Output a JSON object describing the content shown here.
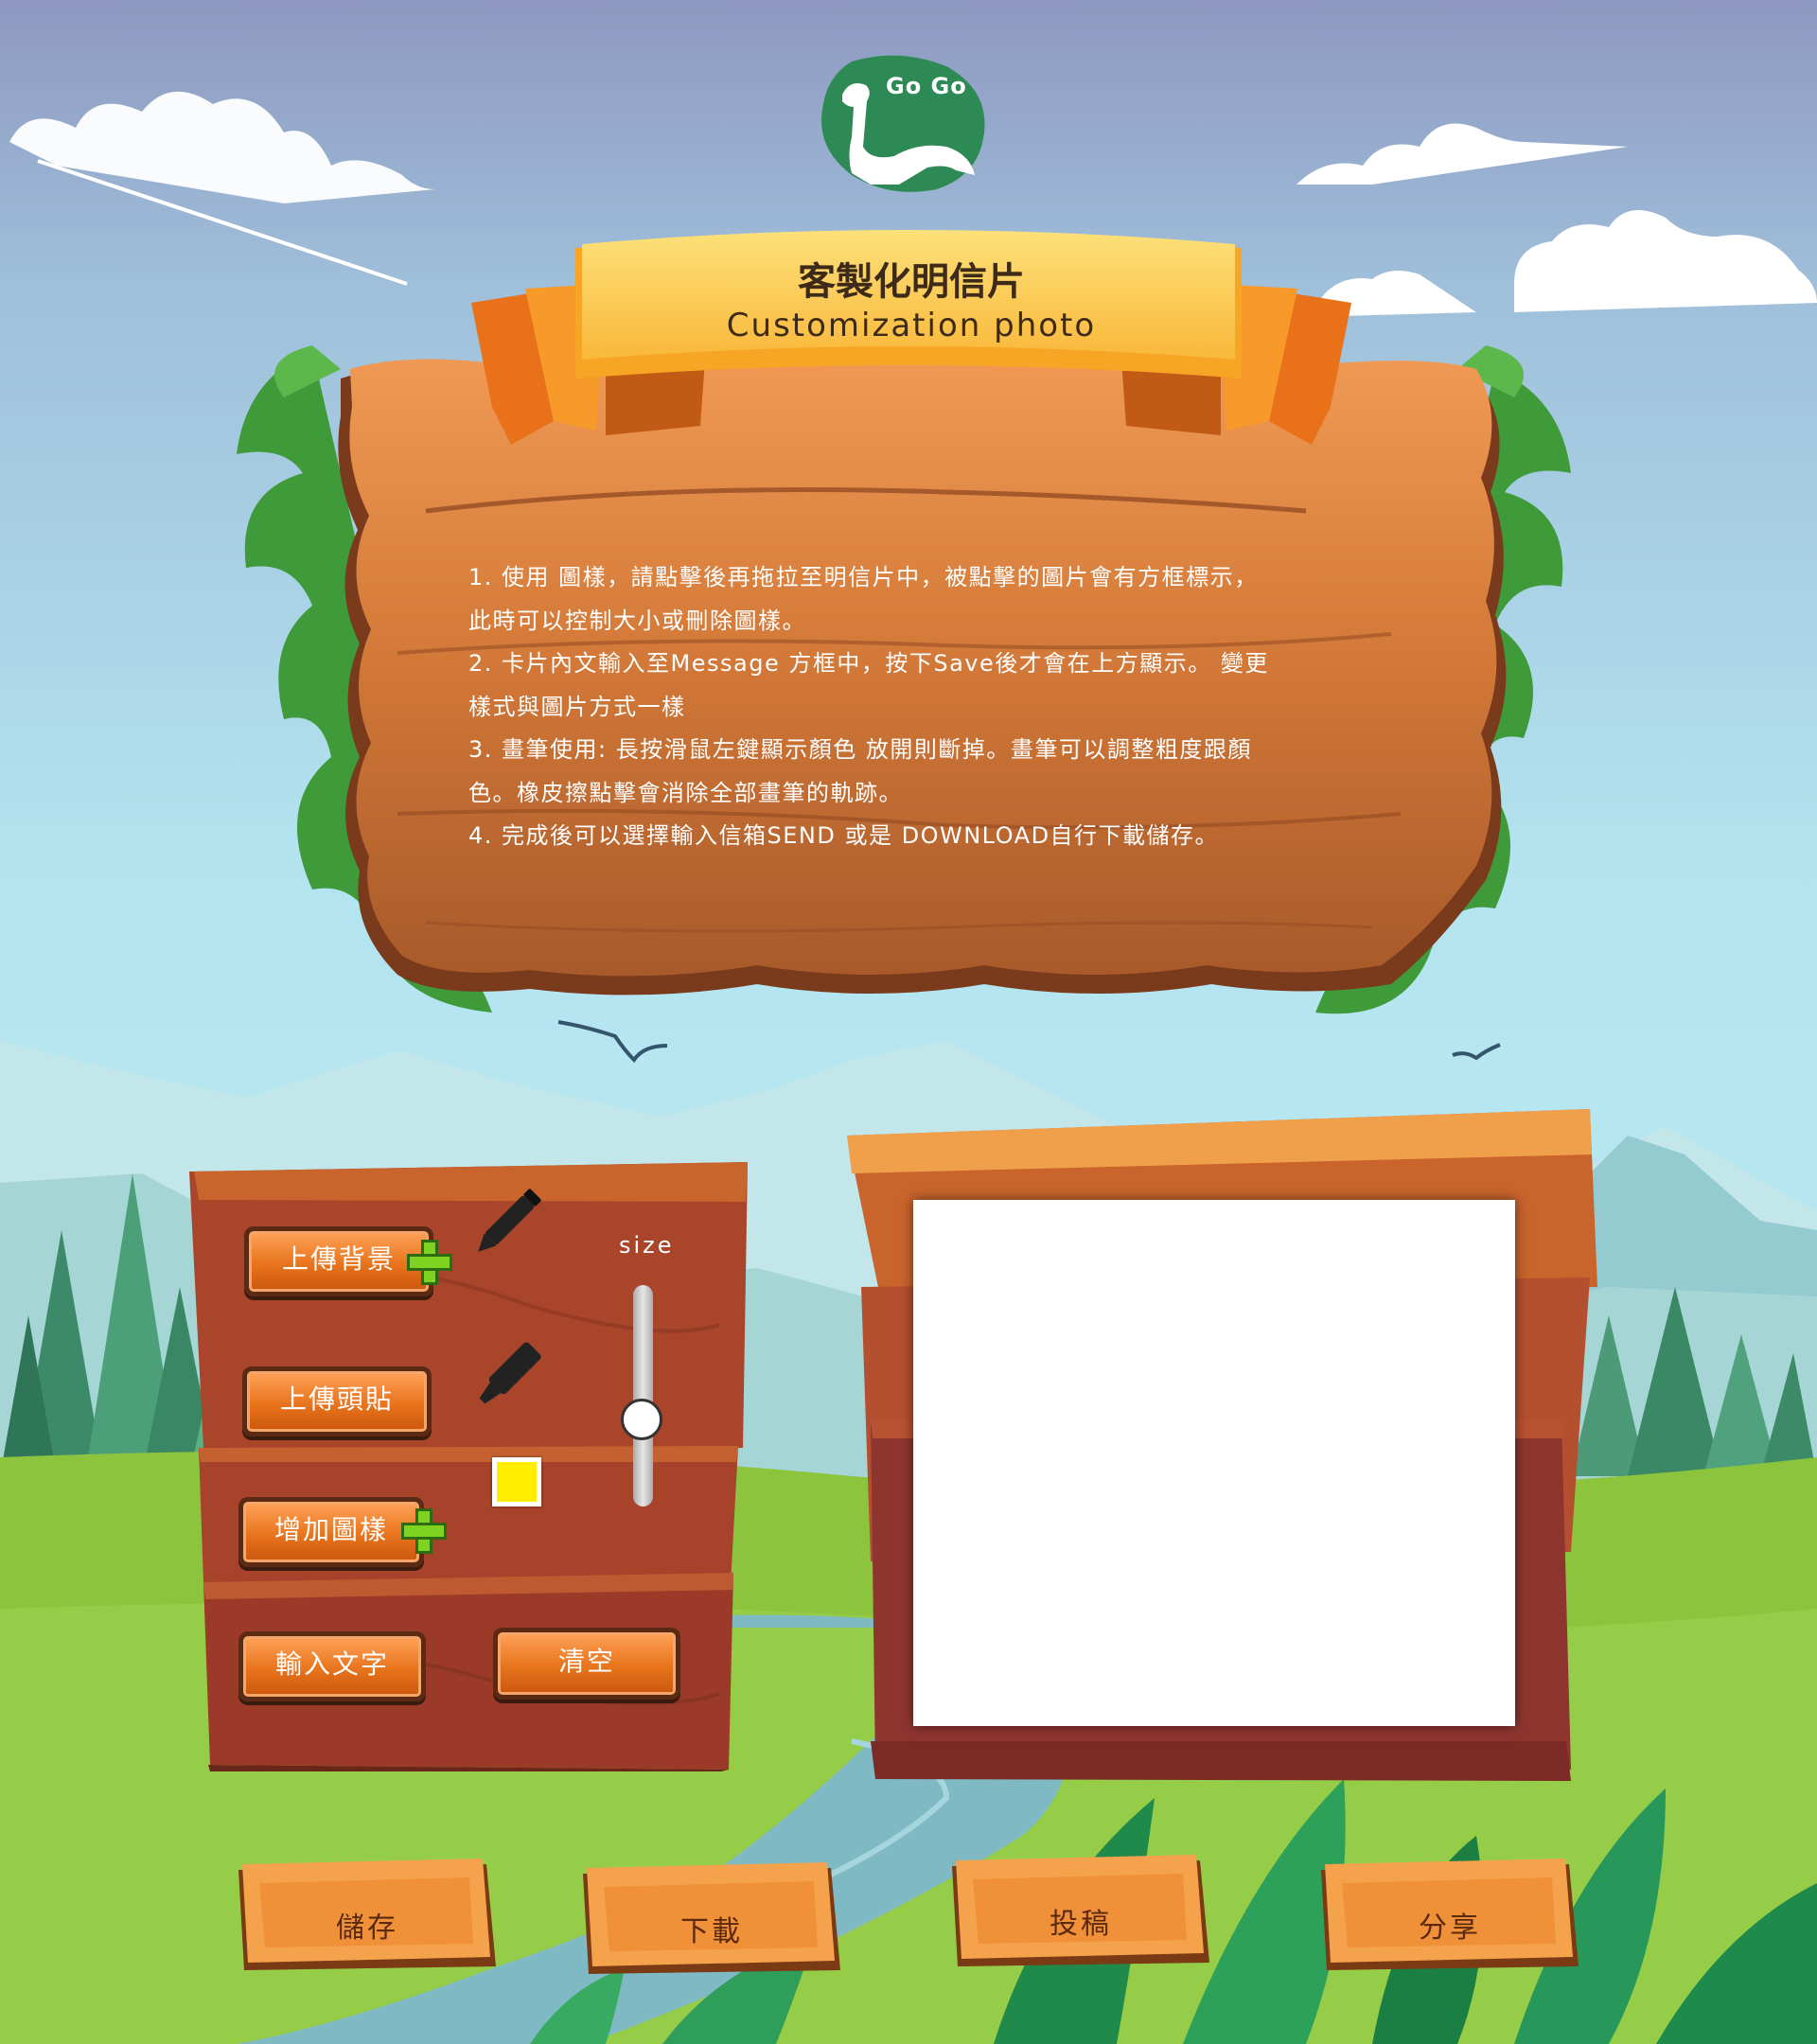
{
  "logo": {
    "text": "Go Go"
  },
  "banner": {
    "title": "客製化明信片",
    "subtitle": "Customization photo"
  },
  "instructions": [
    "1. 使用 圖樣，請點擊後再拖拉至明信片中，被點擊的圖片會有方框標示，",
    "此時可以控制大小或刪除圖樣。",
    "2. 卡片內文輸入至Message 方框中，按下Save後才會在上方顯示。 變更",
    "樣式與圖片方式一樣",
    "3. 畫筆使用: 長按滑鼠左鍵顯示顏色 放開則斷掉。畫筆可以調整粗度跟顏",
    "色。橡皮擦點擊會消除全部畫筆的軌跡。",
    "4. 完成後可以選擇輸入信箱SEND 或是 DOWNLOAD自行下載儲存。"
  ],
  "tools": {
    "upload_background": "上傳背景",
    "upload_avatar": "上傳頭貼",
    "add_sticker": "增加圖樣",
    "input_text": "輸入文字",
    "clear": "清空",
    "size_label": "size",
    "size_value": 0.35,
    "pen_color": "#ffee00",
    "pen_icon": "pencil-icon",
    "marker_icon": "marker-icon"
  },
  "actions": {
    "save": "儲存",
    "download": "下載",
    "submit": "投稿",
    "share": "分享"
  },
  "colors": {
    "wood_light": "#e9924c",
    "wood_dark": "#7a3a1c",
    "button_orange": "#f08a2c",
    "ribbon_yellow": "#fbc53b",
    "grass": "#8cc43e"
  }
}
